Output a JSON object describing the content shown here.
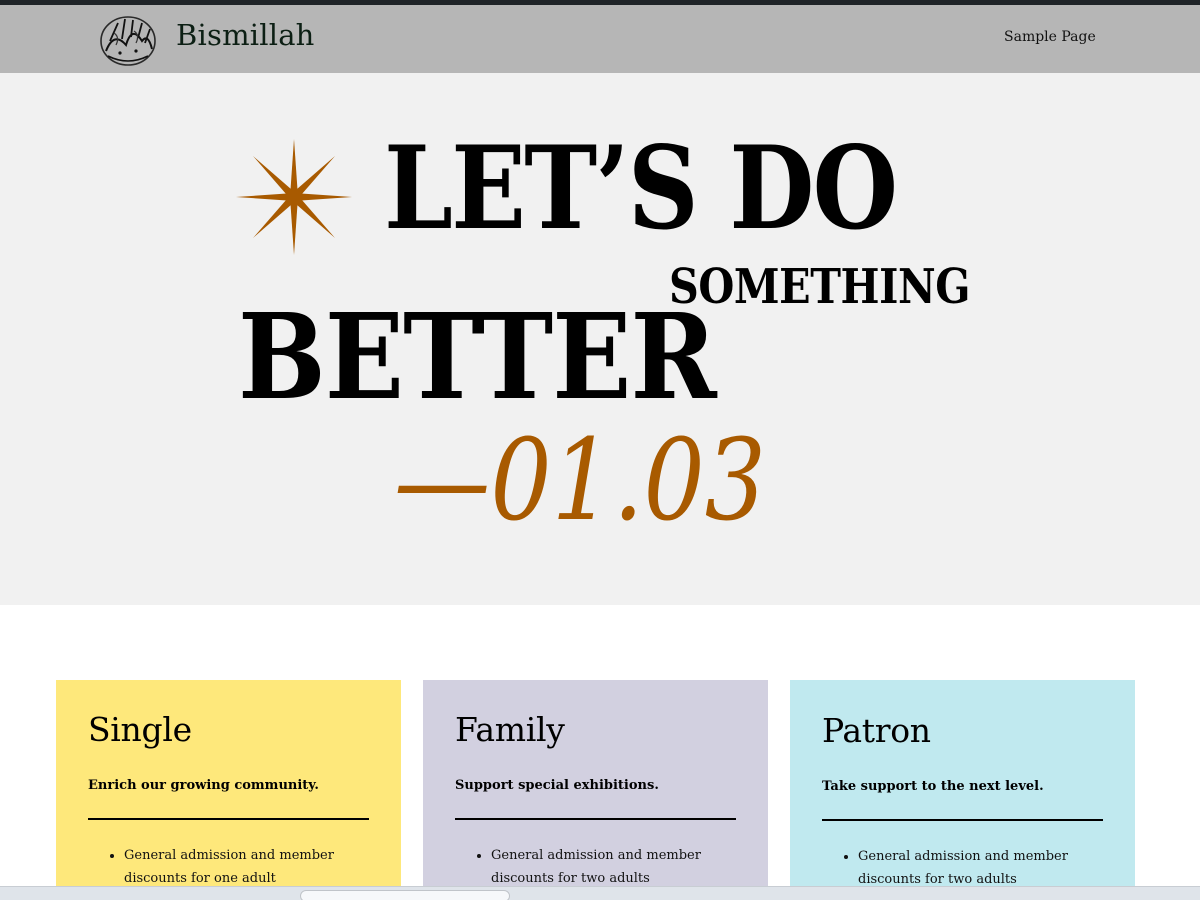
{
  "header": {
    "site_title": "Bismillah",
    "nav": [
      {
        "label": "Sample Page"
      }
    ]
  },
  "hero": {
    "line1": "LET’S DO",
    "line2": "SOMETHING",
    "line3": "BETTER",
    "line4": "—01.03"
  },
  "cards": [
    {
      "title": "Single",
      "tagline": "Enrich our growing community.",
      "features": [
        "General admission and member",
        "discounts for one adult"
      ],
      "color": "#fee87b"
    },
    {
      "title": "Family",
      "tagline": "Support special exhibitions.",
      "features": [
        "General admission and member",
        "discounts for two adults"
      ],
      "color": "#d2d0e0"
    },
    {
      "title": "Patron",
      "tagline": "Take support to the next level.",
      "features": [
        "General admission and member",
        "discounts for two adults"
      ],
      "color": "#c0e9ef"
    }
  ],
  "colors": {
    "header_bg": "#b6b6b6",
    "hero_bg": "#f1f1f1",
    "accent": "#a85a00"
  }
}
